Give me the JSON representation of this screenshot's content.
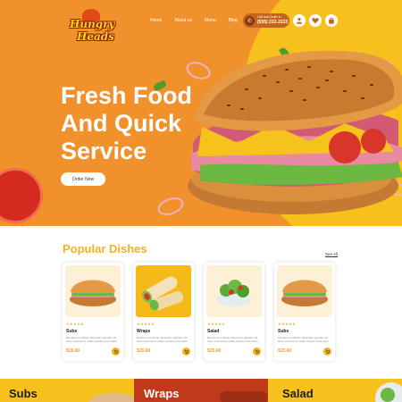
{
  "brand": {
    "line1": "Hungry",
    "line2": "Heads"
  },
  "nav": [
    {
      "label": "Home"
    },
    {
      "label": "About us"
    },
    {
      "label": "Menu"
    },
    {
      "label": "Blog"
    }
  ],
  "call": {
    "caption": "Call and Order in",
    "number": "(555) 222-2223"
  },
  "header_icons": [
    "user-icon",
    "heart-icon",
    "bag-icon"
  ],
  "hero": {
    "title_line1": "Fresh Food",
    "title_line2": "And Quick",
    "title_line3": "Service",
    "cta": "Order Now"
  },
  "popular": {
    "title": "Popular Dishes",
    "see_all": "See All",
    "cards": [
      {
        "name": "Subs",
        "rating": "★★★★★",
        "desc": "Burrata cum dictum bibendum gravida, elit dolor euismod ut mollis, fuscius amet dolor.",
        "price": "$15.60"
      },
      {
        "name": "Wraps",
        "rating": "★★★★★",
        "desc": "Burrata cum dictum bibendum gravida, elit dolor euismod ut mollis, fuscius amet dolor.",
        "price": "$15.60"
      },
      {
        "name": "Salad",
        "rating": "★★★★★",
        "desc": "Burrata cum dictum bibendum gravida, elit dolor euismod ut mollis, fuscius amet dolor.",
        "price": "$15.60"
      },
      {
        "name": "Subs",
        "rating": "★★★★★",
        "desc": "Burrata cum dictum bibendum gravida, elit dolor euismod ut mollis, fuscius amet dolor.",
        "price": "$15.60"
      }
    ]
  },
  "categories": [
    {
      "label": "Subs",
      "bg": "#f6c11c",
      "color": "#1e1e1e"
    },
    {
      "label": "Wraps",
      "bg": "#c0391b",
      "color": "#ffffff"
    },
    {
      "label": "Salad",
      "bg": "#f6c11c",
      "color": "#1e1e1e"
    }
  ],
  "colors": {
    "hero_orange": "#f0912b",
    "accent_yellow": "#f6c11c",
    "price": "#e8a21a"
  }
}
